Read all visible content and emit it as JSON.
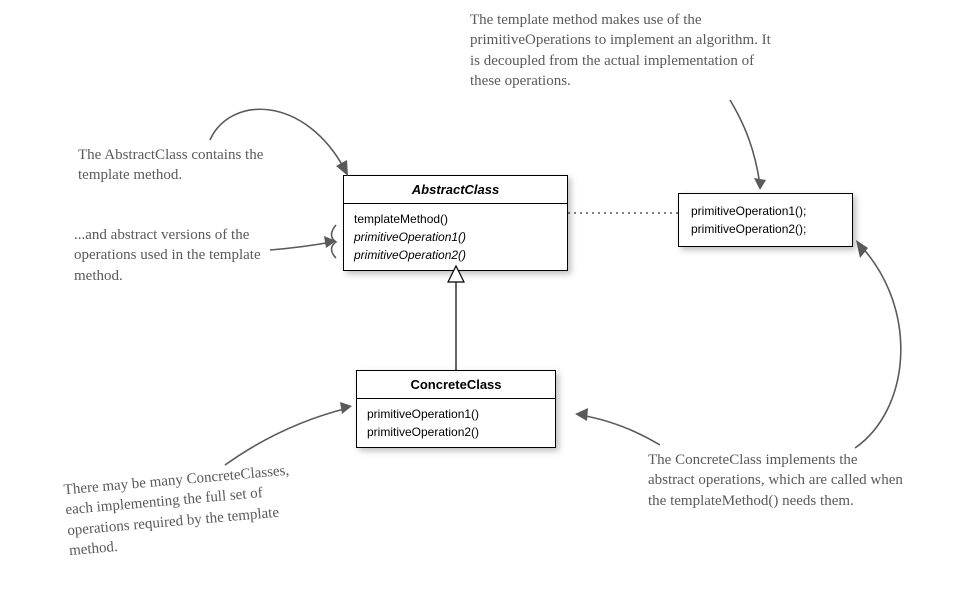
{
  "abstractClass": {
    "title": "AbstractClass",
    "method1": "templateMethod()",
    "method2": "primitiveOperation1()",
    "method3": "primitiveOperation2()"
  },
  "concreteClass": {
    "title": "ConcreteClass",
    "method1": "primitiveOperation1()",
    "method2": "primitiveOperation2()"
  },
  "note": {
    "line1": "primitiveOperation1();",
    "line2": "primitiveOperation2();"
  },
  "annotations": {
    "top": "The template method makes use of the primitiveOperations to implement an algorithm.  It is decoupled from the actual implementation of these operations.",
    "left1": "The AbstractClass contains the template method.",
    "left2": "...and abstract versions of the operations used in the template method.",
    "bottomLeft": "There may be many ConcreteClasses, each implementing the full set of operations required by the template method.",
    "bottomRight": "The ConcreteClass implements the abstract operations, which are called when the templateMethod() needs them."
  }
}
